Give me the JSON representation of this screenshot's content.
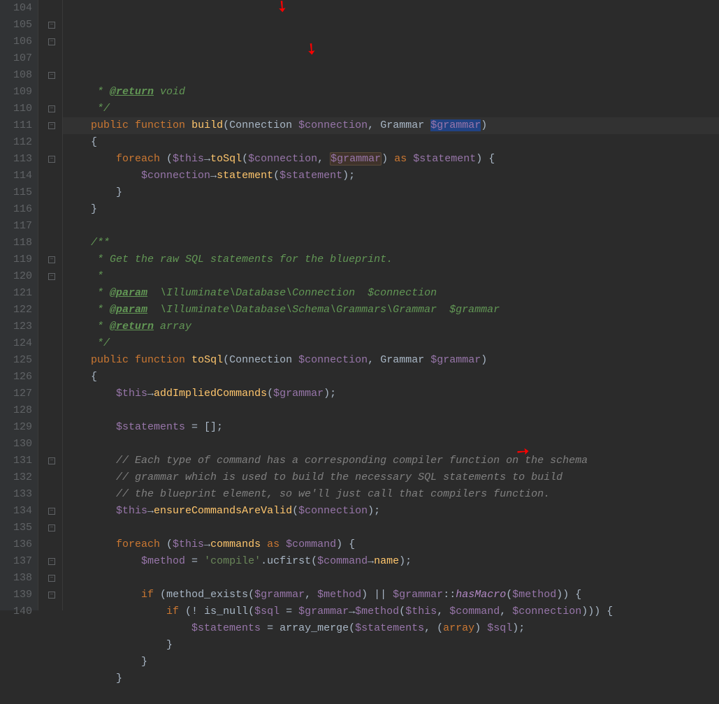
{
  "lines": [
    {
      "n": 104,
      "fold": "",
      "hl": false,
      "tokens": [
        {
          "t": "     ",
          "c": "com"
        },
        {
          "t": "* ",
          "c": "doc"
        },
        {
          "t": "@return",
          "c": "doctag"
        },
        {
          "t": " void",
          "c": "doc"
        }
      ]
    },
    {
      "n": 105,
      "fold": "end",
      "hl": false,
      "tokens": [
        {
          "t": "     ",
          "c": ""
        },
        {
          "t": "*/",
          "c": "doc"
        }
      ]
    },
    {
      "n": 106,
      "fold": "open",
      "hl": true,
      "tokens": [
        {
          "t": "    ",
          "c": ""
        },
        {
          "t": "public",
          "c": "kw"
        },
        {
          "t": " ",
          "c": ""
        },
        {
          "t": "function",
          "c": "kw"
        },
        {
          "t": " ",
          "c": ""
        },
        {
          "t": "build",
          "c": "fn"
        },
        {
          "t": "(",
          "c": "punc"
        },
        {
          "t": "Connection ",
          "c": "type"
        },
        {
          "t": "$connection",
          "c": "var"
        },
        {
          "t": ", ",
          "c": "punc"
        },
        {
          "t": "Grammar ",
          "c": "type"
        },
        {
          "t": "$grammar",
          "c": "var",
          "bg": "sel-bg"
        },
        {
          "t": ")",
          "c": "punc"
        }
      ]
    },
    {
      "n": 107,
      "fold": "",
      "hl": false,
      "tokens": [
        {
          "t": "    {",
          "c": "punc"
        }
      ]
    },
    {
      "n": 108,
      "fold": "open",
      "hl": false,
      "tokens": [
        {
          "t": "        ",
          "c": ""
        },
        {
          "t": "foreach",
          "c": "kw"
        },
        {
          "t": " (",
          "c": "punc"
        },
        {
          "t": "$this",
          "c": "var"
        },
        {
          "t": "→",
          "c": "op"
        },
        {
          "t": "toSql",
          "c": "fn"
        },
        {
          "t": "(",
          "c": "punc"
        },
        {
          "t": "$connection",
          "c": "var"
        },
        {
          "t": ", ",
          "c": "punc"
        },
        {
          "t": "$grammar",
          "c": "var",
          "bg": "usage-bg"
        },
        {
          "t": ") ",
          "c": "punc"
        },
        {
          "t": "as",
          "c": "kw"
        },
        {
          "t": " ",
          "c": ""
        },
        {
          "t": "$statement",
          "c": "var"
        },
        {
          "t": ") {",
          "c": "punc"
        }
      ]
    },
    {
      "n": 109,
      "fold": "",
      "hl": false,
      "tokens": [
        {
          "t": "            ",
          "c": ""
        },
        {
          "t": "$connection",
          "c": "var"
        },
        {
          "t": "→",
          "c": "op"
        },
        {
          "t": "statement",
          "c": "fn"
        },
        {
          "t": "(",
          "c": "punc"
        },
        {
          "t": "$statement",
          "c": "var"
        },
        {
          "t": ");",
          "c": "punc"
        }
      ]
    },
    {
      "n": 110,
      "fold": "end",
      "hl": false,
      "tokens": [
        {
          "t": "        }",
          "c": "punc"
        }
      ]
    },
    {
      "n": 111,
      "fold": "end",
      "hl": false,
      "tokens": [
        {
          "t": "    }",
          "c": "punc"
        }
      ]
    },
    {
      "n": 112,
      "fold": "",
      "hl": false,
      "tokens": []
    },
    {
      "n": 113,
      "fold": "open",
      "hl": false,
      "tokens": [
        {
          "t": "    ",
          "c": ""
        },
        {
          "t": "/**",
          "c": "doc"
        }
      ]
    },
    {
      "n": 114,
      "fold": "",
      "hl": false,
      "tokens": [
        {
          "t": "     ",
          "c": ""
        },
        {
          "t": "* Get the raw SQL statements for the blueprint.",
          "c": "doc"
        }
      ]
    },
    {
      "n": 115,
      "fold": "",
      "hl": false,
      "tokens": [
        {
          "t": "     ",
          "c": ""
        },
        {
          "t": "*",
          "c": "doc"
        }
      ]
    },
    {
      "n": 116,
      "fold": "",
      "hl": false,
      "tokens": [
        {
          "t": "     ",
          "c": ""
        },
        {
          "t": "* ",
          "c": "doc"
        },
        {
          "t": "@param",
          "c": "doctag"
        },
        {
          "t": "  \\Illuminate\\Database\\Connection  ",
          "c": "doc"
        },
        {
          "t": "$connection",
          "c": "doc"
        }
      ]
    },
    {
      "n": 117,
      "fold": "",
      "hl": false,
      "tokens": [
        {
          "t": "     ",
          "c": ""
        },
        {
          "t": "* ",
          "c": "doc"
        },
        {
          "t": "@param",
          "c": "doctag"
        },
        {
          "t": "  \\Illuminate\\Database\\Schema\\Grammars\\Grammar  ",
          "c": "doc"
        },
        {
          "t": "$grammar",
          "c": "doc"
        }
      ]
    },
    {
      "n": 118,
      "fold": "",
      "hl": false,
      "tokens": [
        {
          "t": "     ",
          "c": ""
        },
        {
          "t": "* ",
          "c": "doc"
        },
        {
          "t": "@return",
          "c": "doctag"
        },
        {
          "t": " array",
          "c": "doc"
        }
      ]
    },
    {
      "n": 119,
      "fold": "end",
      "hl": false,
      "tokens": [
        {
          "t": "     ",
          "c": ""
        },
        {
          "t": "*/",
          "c": "doc"
        }
      ]
    },
    {
      "n": 120,
      "fold": "open",
      "hl": false,
      "tokens": [
        {
          "t": "    ",
          "c": ""
        },
        {
          "t": "public",
          "c": "kw"
        },
        {
          "t": " ",
          "c": ""
        },
        {
          "t": "function",
          "c": "kw"
        },
        {
          "t": " ",
          "c": ""
        },
        {
          "t": "toSql",
          "c": "fn"
        },
        {
          "t": "(",
          "c": "punc"
        },
        {
          "t": "Connection ",
          "c": "type"
        },
        {
          "t": "$connection",
          "c": "var"
        },
        {
          "t": ", ",
          "c": "punc"
        },
        {
          "t": "Grammar ",
          "c": "type"
        },
        {
          "t": "$grammar",
          "c": "var"
        },
        {
          "t": ")",
          "c": "punc"
        }
      ]
    },
    {
      "n": 121,
      "fold": "",
      "hl": false,
      "tokens": [
        {
          "t": "    {",
          "c": "punc"
        }
      ]
    },
    {
      "n": 122,
      "fold": "",
      "hl": false,
      "tokens": [
        {
          "t": "        ",
          "c": ""
        },
        {
          "t": "$this",
          "c": "var"
        },
        {
          "t": "→",
          "c": "op"
        },
        {
          "t": "addImpliedCommands",
          "c": "fn"
        },
        {
          "t": "(",
          "c": "punc"
        },
        {
          "t": "$grammar",
          "c": "var"
        },
        {
          "t": ");",
          "c": "punc"
        }
      ]
    },
    {
      "n": 123,
      "fold": "",
      "hl": false,
      "tokens": []
    },
    {
      "n": 124,
      "fold": "",
      "hl": false,
      "tokens": [
        {
          "t": "        ",
          "c": ""
        },
        {
          "t": "$statements",
          "c": "var"
        },
        {
          "t": " = [];",
          "c": "punc"
        }
      ]
    },
    {
      "n": 125,
      "fold": "",
      "hl": false,
      "tokens": []
    },
    {
      "n": 126,
      "fold": "",
      "hl": false,
      "tokens": [
        {
          "t": "        ",
          "c": ""
        },
        {
          "t": "// Each type of command has a corresponding compiler function on the schema",
          "c": "com"
        }
      ]
    },
    {
      "n": 127,
      "fold": "",
      "hl": false,
      "tokens": [
        {
          "t": "        ",
          "c": ""
        },
        {
          "t": "// grammar which is used to build the necessary SQL statements to build",
          "c": "com"
        }
      ]
    },
    {
      "n": 128,
      "fold": "",
      "hl": false,
      "tokens": [
        {
          "t": "        ",
          "c": ""
        },
        {
          "t": "// the blueprint element, so we'll just call that compilers function.",
          "c": "com"
        }
      ]
    },
    {
      "n": 129,
      "fold": "",
      "hl": false,
      "tokens": [
        {
          "t": "        ",
          "c": ""
        },
        {
          "t": "$this",
          "c": "var"
        },
        {
          "t": "→",
          "c": "op"
        },
        {
          "t": "ensureCommandsAreValid",
          "c": "fn"
        },
        {
          "t": "(",
          "c": "punc"
        },
        {
          "t": "$connection",
          "c": "var"
        },
        {
          "t": ");",
          "c": "punc"
        }
      ]
    },
    {
      "n": 130,
      "fold": "",
      "hl": false,
      "tokens": []
    },
    {
      "n": 131,
      "fold": "open",
      "hl": false,
      "tokens": [
        {
          "t": "        ",
          "c": ""
        },
        {
          "t": "foreach",
          "c": "kw"
        },
        {
          "t": " (",
          "c": "punc"
        },
        {
          "t": "$this",
          "c": "var"
        },
        {
          "t": "→",
          "c": "op"
        },
        {
          "t": "commands ",
          "c": "fn"
        },
        {
          "t": "as",
          "c": "kw"
        },
        {
          "t": " ",
          "c": ""
        },
        {
          "t": "$command",
          "c": "var"
        },
        {
          "t": ") {",
          "c": "punc"
        }
      ]
    },
    {
      "n": 132,
      "fold": "",
      "hl": false,
      "tokens": [
        {
          "t": "            ",
          "c": ""
        },
        {
          "t": "$method",
          "c": "var"
        },
        {
          "t": " = ",
          "c": "punc"
        },
        {
          "t": "'compile'",
          "c": "str"
        },
        {
          "t": ".",
          "c": "punc"
        },
        {
          "t": "ucfirst",
          "c": "type"
        },
        {
          "t": "(",
          "c": "punc"
        },
        {
          "t": "$command",
          "c": "var"
        },
        {
          "t": "→",
          "c": "op"
        },
        {
          "t": "name",
          "c": "fn"
        },
        {
          "t": ");",
          "c": "punc"
        }
      ]
    },
    {
      "n": 133,
      "fold": "",
      "hl": false,
      "tokens": []
    },
    {
      "n": 134,
      "fold": "open",
      "hl": false,
      "tokens": [
        {
          "t": "            ",
          "c": ""
        },
        {
          "t": "if",
          "c": "kw"
        },
        {
          "t": " (",
          "c": "punc"
        },
        {
          "t": "method_exists",
          "c": "type"
        },
        {
          "t": "(",
          "c": "punc"
        },
        {
          "t": "$grammar",
          "c": "var"
        },
        {
          "t": ", ",
          "c": "punc"
        },
        {
          "t": "$method",
          "c": "var"
        },
        {
          "t": ") || ",
          "c": "punc"
        },
        {
          "t": "$grammar",
          "c": "var"
        },
        {
          "t": "::",
          "c": "punc"
        },
        {
          "t": "hasMacro",
          "c": "method-ref"
        },
        {
          "t": "(",
          "c": "punc"
        },
        {
          "t": "$method",
          "c": "var"
        },
        {
          "t": ")) {",
          "c": "punc"
        }
      ]
    },
    {
      "n": 135,
      "fold": "open",
      "hl": false,
      "tokens": [
        {
          "t": "                ",
          "c": ""
        },
        {
          "t": "if",
          "c": "kw"
        },
        {
          "t": " (! ",
          "c": "punc"
        },
        {
          "t": "is_null",
          "c": "type"
        },
        {
          "t": "(",
          "c": "punc"
        },
        {
          "t": "$sql",
          "c": "var"
        },
        {
          "t": " = ",
          "c": "punc"
        },
        {
          "t": "$grammar",
          "c": "var"
        },
        {
          "t": "→",
          "c": "op"
        },
        {
          "t": "$method",
          "c": "var"
        },
        {
          "t": "(",
          "c": "punc"
        },
        {
          "t": "$this",
          "c": "var"
        },
        {
          "t": ", ",
          "c": "punc"
        },
        {
          "t": "$command",
          "c": "var"
        },
        {
          "t": ", ",
          "c": "punc"
        },
        {
          "t": "$connection",
          "c": "var"
        },
        {
          "t": "))) {",
          "c": "punc"
        }
      ]
    },
    {
      "n": 136,
      "fold": "",
      "hl": false,
      "tokens": [
        {
          "t": "                    ",
          "c": ""
        },
        {
          "t": "$statements",
          "c": "var"
        },
        {
          "t": " = ",
          "c": "punc"
        },
        {
          "t": "array_merge",
          "c": "type"
        },
        {
          "t": "(",
          "c": "punc"
        },
        {
          "t": "$statements",
          "c": "var"
        },
        {
          "t": ", (",
          "c": "punc"
        },
        {
          "t": "array",
          "c": "kw"
        },
        {
          "t": ") ",
          "c": "punc"
        },
        {
          "t": "$sql",
          "c": "var"
        },
        {
          "t": ");",
          "c": "punc"
        }
      ]
    },
    {
      "n": 137,
      "fold": "end",
      "hl": false,
      "tokens": [
        {
          "t": "                }",
          "c": "punc"
        }
      ]
    },
    {
      "n": 138,
      "fold": "end",
      "hl": false,
      "tokens": [
        {
          "t": "            }",
          "c": "punc"
        }
      ]
    },
    {
      "n": 139,
      "fold": "end",
      "hl": false,
      "tokens": [
        {
          "t": "        }",
          "c": "punc"
        }
      ]
    },
    {
      "n": 140,
      "fold": "",
      "hl": false,
      "tokens": []
    }
  ]
}
